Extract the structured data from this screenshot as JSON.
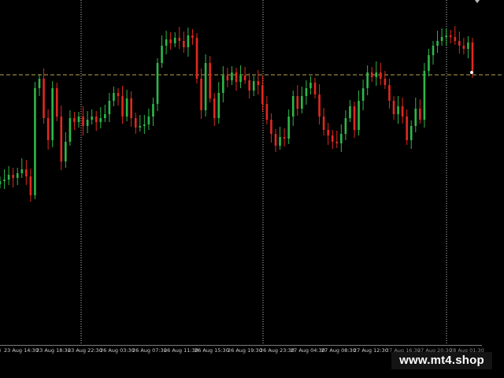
{
  "colors": {
    "background": "#000000",
    "bull": "#2db84a",
    "bear": "#e0291f",
    "grid": "#c8c8c8",
    "price_line": "#b8a64a",
    "axis_text": "#cfcfcf"
  },
  "watermark": "www.mt4.shop",
  "chart_data": {
    "type": "candlestick",
    "grid": "vertical dotted at selected session labels",
    "horizontal_line": "current price level (dashed)",
    "x_tick_labels": [
      "8",
      "23 Aug 14:30",
      "23 Aug 18:30",
      "23 Aug 22:30",
      "26 Aug 03:30",
      "26 Aug 07:30",
      "26 Aug 11:30",
      "26 Aug 15:30",
      "26 Aug 19:30",
      "26 Aug 23:30",
      "27 Aug 04:30",
      "27 Aug 08:30",
      "27 Aug 12:30",
      "27 Aug 16:30",
      "27 Aug 20:30",
      "28 Aug 01:30"
    ],
    "close_series": [
      230,
      228,
      222,
      226,
      220,
      215,
      224,
      248,
      112,
      100,
      150,
      178,
      112,
      148,
      205,
      180,
      150,
      155,
      148,
      160,
      152,
      148,
      155,
      150,
      145,
      128,
      118,
      122,
      148,
      125,
      150,
      162,
      160,
      158,
      148,
      132,
      80,
      58,
      50,
      55,
      48,
      52,
      60,
      45,
      48,
      100,
      140,
      80,
      125,
      150,
      118,
      96,
      102,
      92,
      104,
      96,
      102,
      115,
      103,
      108,
      132,
      152,
      170,
      185,
      174,
      176,
      148,
      122,
      138,
      122,
      112,
      105,
      120,
      148,
      165,
      172,
      180,
      182,
      170,
      150,
      135,
      165,
      128,
      112,
      92,
      98,
      92,
      100,
      108,
      128,
      145,
      135,
      148,
      178,
      160,
      138,
      152,
      90,
      70,
      58,
      52,
      47,
      45,
      47,
      52,
      58,
      62,
      54,
      90
    ]
  }
}
